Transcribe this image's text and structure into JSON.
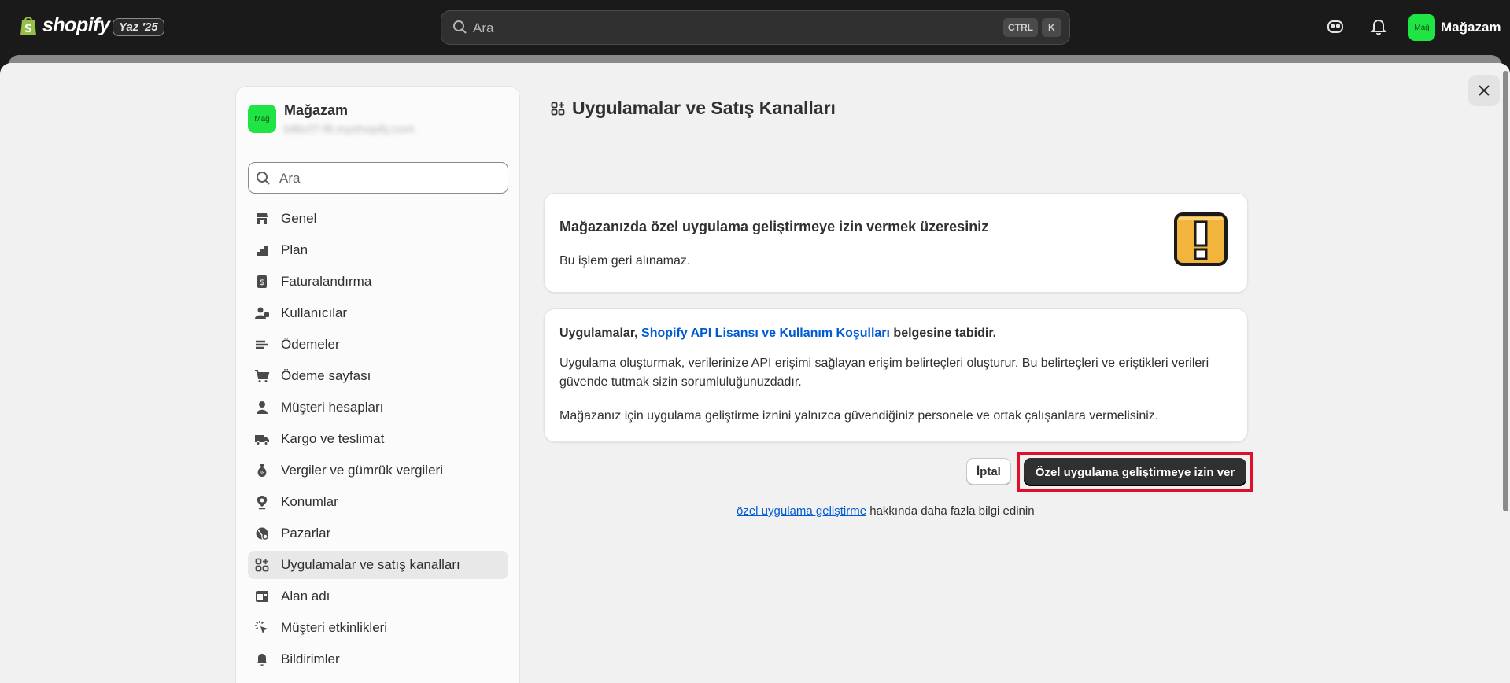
{
  "topbar": {
    "logo_text": "shopify",
    "badge": "Yaz '25",
    "search_placeholder": "Ara",
    "kbd_ctrl": "CTRL",
    "kbd_k": "K",
    "avatar_text": "Mağ",
    "store_name": "Mağazam"
  },
  "sidebar": {
    "avatar_text": "Mağ",
    "store_name": "Mağazam",
    "email": "b8bcf7-f8.myshopify.com",
    "search_placeholder": "Ara",
    "items": [
      {
        "label": "Genel",
        "icon": "store-icon"
      },
      {
        "label": "Plan",
        "icon": "plan-icon"
      },
      {
        "label": "Faturalandırma",
        "icon": "billing-icon"
      },
      {
        "label": "Kullanıcılar",
        "icon": "users-icon"
      },
      {
        "label": "Ödemeler",
        "icon": "payments-icon"
      },
      {
        "label": "Ödeme sayfası",
        "icon": "cart-icon"
      },
      {
        "label": "Müşteri hesapları",
        "icon": "person-icon"
      },
      {
        "label": "Kargo ve teslimat",
        "icon": "truck-icon"
      },
      {
        "label": "Vergiler ve gümrük vergileri",
        "icon": "tax-icon"
      },
      {
        "label": "Konumlar",
        "icon": "location-icon"
      },
      {
        "label": "Pazarlar",
        "icon": "globe-icon"
      },
      {
        "label": "Uygulamalar ve satış kanalları",
        "icon": "apps-icon",
        "active": true
      },
      {
        "label": "Alan adı",
        "icon": "domain-icon"
      },
      {
        "label": "Müşteri etkinlikleri",
        "icon": "cursor-icon"
      },
      {
        "label": "Bildirimler",
        "icon": "bell-icon"
      }
    ]
  },
  "main": {
    "title": "Uygulamalar ve Satış Kanalları",
    "warning": {
      "title": "Mağazanızda özel uygulama geliştirmeye izin vermek üzeresiniz",
      "subtitle": "Bu işlem geri alınamaz."
    },
    "terms": {
      "prefix": "Uygulamalar, ",
      "link": "Shopify API Lisansı ve Kullanım Koşulları",
      "suffix": " belgesine tabidir.",
      "paragraph1": "Uygulama oluşturmak, verilerinize API erişimi sağlayan erişim belirteçleri oluşturur. Bu belirteçleri ve eriştikleri verileri güvende tutmak sizin sorumluluğunuzdadır.",
      "paragraph2": "Mağazanız için uygulama geliştirme iznini yalnızca güvendiğiniz personele ve ortak çalışanlara vermelisiniz."
    },
    "cancel_label": "İptal",
    "primary_label": "Özel uygulama geliştirmeye izin ver",
    "learn": {
      "link": "özel uygulama geliştirme",
      "suffix": " hakkında daha fazla bilgi edinin"
    }
  }
}
